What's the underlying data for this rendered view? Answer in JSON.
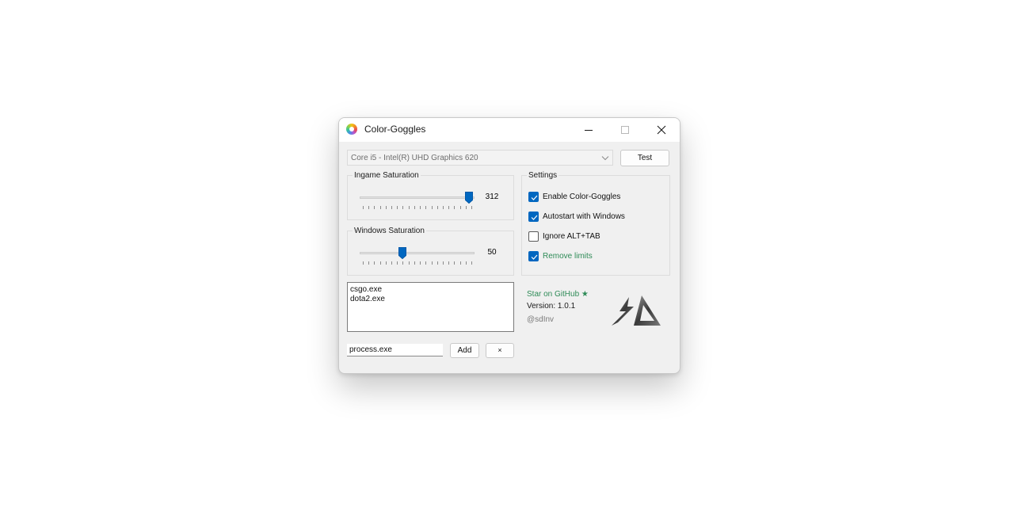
{
  "window": {
    "title": "Color-Goggles"
  },
  "gpu_select": {
    "value": "Core i5 - Intel(R) UHD Graphics 620"
  },
  "test_button": "Test",
  "ingame_saturation": {
    "label": "Ingame Saturation",
    "value": "312",
    "level": 0.95
  },
  "windows_saturation": {
    "label": "Windows Saturation",
    "value": "50",
    "level": 0.37
  },
  "settings": {
    "label": "Settings",
    "options": [
      {
        "label": "Enable Color-Goggles",
        "checked": true
      },
      {
        "label": "Autostart with Windows",
        "checked": true
      },
      {
        "label": "Ignore ALT+TAB",
        "checked": false
      },
      {
        "label": "Remove limits",
        "checked": true
      }
    ]
  },
  "processes": [
    "csgo.exe",
    "dota2.exe"
  ],
  "process_input": {
    "value": "process.exe"
  },
  "add_button": "Add",
  "remove_button": "×",
  "info": {
    "github_link": "Star on GitHub ★",
    "version": "Version: 1.0.1",
    "author": "@sdInv"
  },
  "colors": {
    "accent": "#0067c0",
    "link_green": "#2e8b57"
  },
  "icons": [
    "app-color-wheel-icon",
    "minimize-icon",
    "maximize-icon",
    "close-icon",
    "chevron-down-icon",
    "checkmark-icon",
    "sd-logo"
  ]
}
